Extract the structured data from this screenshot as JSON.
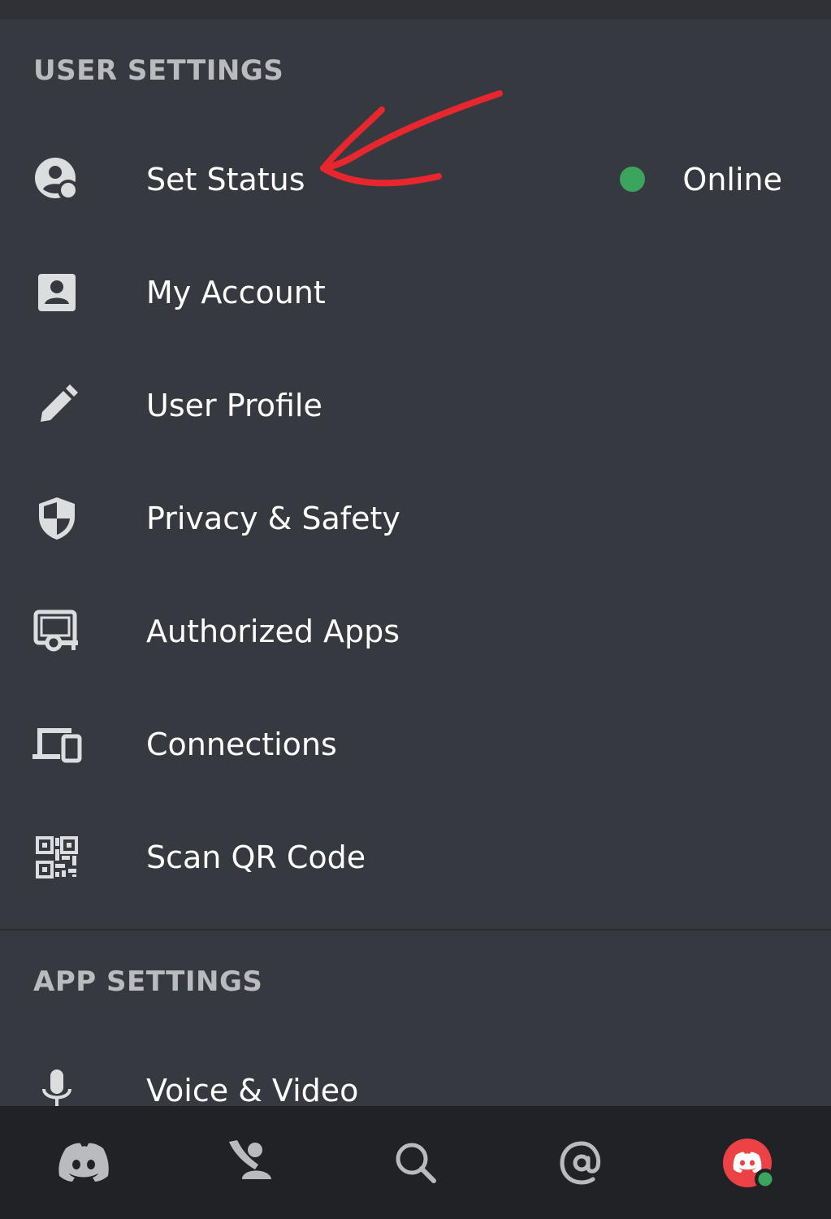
{
  "user_settings": {
    "header": "USER SETTINGS",
    "items": [
      {
        "label": "Set Status",
        "icon": "set-status-icon"
      },
      {
        "label": "My Account",
        "icon": "account-icon"
      },
      {
        "label": "User Profile",
        "icon": "pencil-icon"
      },
      {
        "label": "Privacy & Safety",
        "icon": "shield-icon"
      },
      {
        "label": "Authorized Apps",
        "icon": "authorized-apps-icon"
      },
      {
        "label": "Connections",
        "icon": "devices-icon"
      },
      {
        "label": "Scan QR Code",
        "icon": "qr-code-icon"
      }
    ],
    "status": {
      "text": "Online",
      "color": "#3ba55d"
    }
  },
  "app_settings": {
    "header": "APP SETTINGS",
    "items": [
      {
        "label": "Voice & Video",
        "icon": "microphone-icon"
      }
    ]
  },
  "bottom_nav": {
    "items": [
      {
        "name": "home",
        "icon": "discord-home-icon"
      },
      {
        "name": "friends",
        "icon": "friends-icon"
      },
      {
        "name": "search",
        "icon": "search-icon"
      },
      {
        "name": "mentions",
        "icon": "mentions-icon"
      },
      {
        "name": "profile",
        "icon": "user-avatar-icon"
      }
    ],
    "avatar_color": "#ed4245",
    "avatar_status_color": "#3ba55d"
  },
  "colors": {
    "background": "#36393f",
    "nav_background": "#202225",
    "header_text": "#b9bbbe",
    "icon": "#dcddde",
    "annotation_arrow": "#e8262d"
  }
}
